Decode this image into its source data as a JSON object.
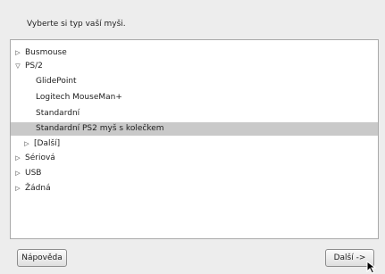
{
  "prompt": "Vyberte si typ vaší myši.",
  "tree": [
    {
      "label": "Busmouse",
      "expander": "▷"
    },
    {
      "label": "PS/2",
      "expander": "▽"
    },
    {
      "label": "GlidePoint",
      "expander": ""
    },
    {
      "label": "Logitech MouseMan+",
      "expander": ""
    },
    {
      "label": "Standardní",
      "expander": ""
    },
    {
      "label": "Standardní PS2 myš s kolečkem",
      "expander": "",
      "selected": true
    },
    {
      "label": "[Další]",
      "expander": "▷"
    },
    {
      "label": "Sériová",
      "expander": "▷"
    },
    {
      "label": "USB",
      "expander": "▷"
    },
    {
      "label": "Žádná",
      "expander": "▷"
    }
  ],
  "buttons": {
    "help": "Nápověda",
    "next": "Další ->"
  }
}
